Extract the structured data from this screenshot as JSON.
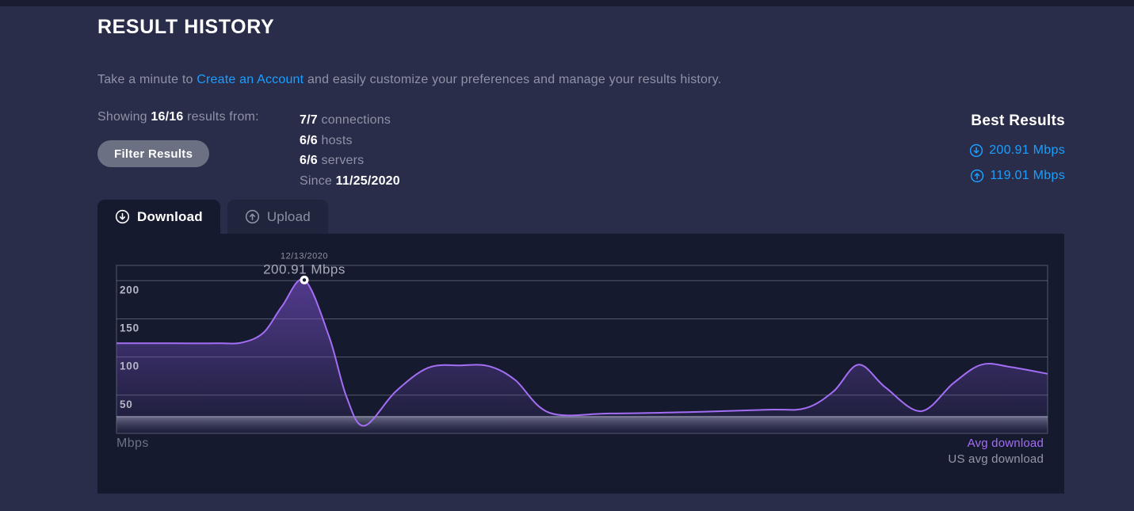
{
  "header": {
    "title": "RESULT HISTORY"
  },
  "intro": {
    "before": "Take a minute to ",
    "link": "Create an Account",
    "after": " and easily customize your preferences and manage your results history."
  },
  "summary": {
    "showing_before": "Showing ",
    "showing_value": "16/16",
    "showing_after": " results from:",
    "filter_button": "Filter Results",
    "stats": [
      {
        "value": "7/7",
        "label": " connections"
      },
      {
        "value": "6/6",
        "label": " hosts"
      },
      {
        "value": "6/6",
        "label": " servers"
      }
    ],
    "since_label": "Since ",
    "since_value": "11/25/2020"
  },
  "best_results": {
    "title": "Best Results",
    "download": "200.91 Mbps",
    "upload": "119.01 Mbps"
  },
  "tabs": [
    {
      "label": "Download",
      "icon": "circle-arrow-down-icon",
      "active": true
    },
    {
      "label": "Upload",
      "icon": "circle-arrow-up-icon",
      "active": false
    }
  ],
  "icons": {
    "best_download": "circle-arrow-down-icon",
    "best_upload": "circle-arrow-up-icon"
  },
  "colors": {
    "accent_blue": "#1b9fff",
    "line_purple": "#a36ef4",
    "fill_purple": "#8255d7",
    "legend_purple": "#a46df2",
    "legend_grey": "#9498a8",
    "page_bg": "#292d4a",
    "panel_bg": "#161a2f"
  },
  "chart_data": {
    "type": "area",
    "title": "",
    "xlabel": "",
    "ylabel": "Mbps",
    "yticks": [
      50,
      100,
      150,
      200
    ],
    "ylim": [
      0,
      220
    ],
    "grid": "horizontal",
    "legend_position": "bottom-right",
    "series": [
      {
        "name": "Avg download",
        "color": "#a36ef4",
        "points": [
          [
            0.0,
            118
          ],
          [
            0.06,
            118
          ],
          [
            0.11,
            118
          ],
          [
            0.135,
            119
          ],
          [
            0.158,
            132
          ],
          [
            0.178,
            167
          ],
          [
            0.2017,
            200.91
          ],
          [
            0.228,
            128
          ],
          [
            0.247,
            48
          ],
          [
            0.266,
            10
          ],
          [
            0.3,
            55
          ],
          [
            0.335,
            86
          ],
          [
            0.37,
            89
          ],
          [
            0.4,
            88
          ],
          [
            0.428,
            70
          ],
          [
            0.465,
            27
          ],
          [
            0.53,
            26
          ],
          [
            0.62,
            28
          ],
          [
            0.7,
            31
          ],
          [
            0.74,
            33
          ],
          [
            0.77,
            55
          ],
          [
            0.797,
            90
          ],
          [
            0.826,
            60
          ],
          [
            0.864,
            29
          ],
          [
            0.899,
            66
          ],
          [
            0.929,
            90
          ],
          [
            0.96,
            87
          ],
          [
            1.0,
            78
          ]
        ]
      }
    ],
    "us_avg_band": {
      "label": "US avg download",
      "from": 0,
      "to": 22
    },
    "annotation": {
      "date": "12/13/2020",
      "value_label": "200.91 Mbps",
      "x": 0.2017,
      "value": 200.91
    }
  }
}
